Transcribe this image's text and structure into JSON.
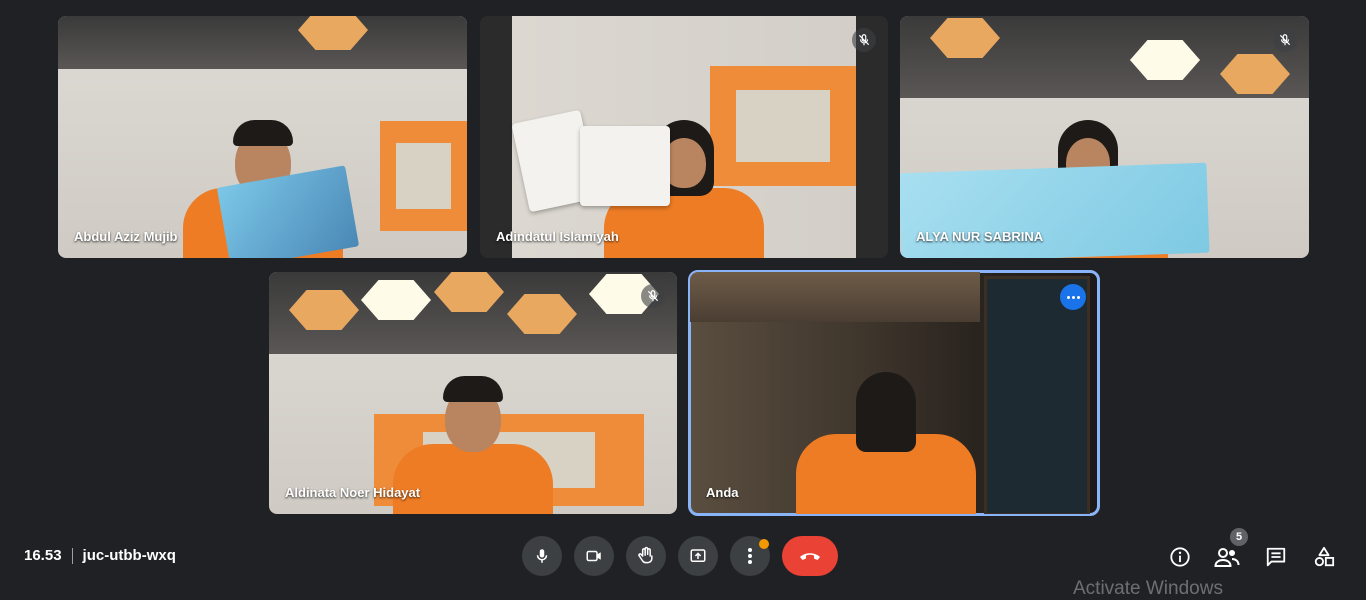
{
  "participants": [
    {
      "name": "Abdul Aziz Mujib",
      "muted": false
    },
    {
      "name": "Adindatul Islamiyah",
      "muted": true
    },
    {
      "name": "ALYA NUR SABRINA",
      "muted": true
    },
    {
      "name": "Aldinata Noer Hidayat",
      "muted": true
    },
    {
      "name": "Anda",
      "muted": false,
      "active_speaker": true
    }
  ],
  "bottom_bar": {
    "time": "16.53",
    "meeting_code": "juc-utbb-wxq",
    "controls": [
      {
        "name": "microphone",
        "icon": "microphone-icon"
      },
      {
        "name": "camera",
        "icon": "video-camera-icon"
      },
      {
        "name": "raise-hand",
        "icon": "hand-icon"
      },
      {
        "name": "present-screen",
        "icon": "present-icon"
      },
      {
        "name": "more-options",
        "icon": "more-vert-icon",
        "has_notification": true
      },
      {
        "name": "end-call",
        "icon": "phone-hangup-icon"
      }
    ],
    "right_icons": [
      {
        "name": "meeting-details",
        "icon": "info-icon"
      },
      {
        "name": "people",
        "icon": "people-icon",
        "badge": "5"
      },
      {
        "name": "chat",
        "icon": "chat-icon"
      },
      {
        "name": "activities",
        "icon": "activities-icon"
      }
    ]
  },
  "colors": {
    "background": "#202124",
    "control": "#3c4043",
    "end_call": "#ea4335",
    "active_border": "#8ab4f8",
    "accent_blue": "#1a73e8",
    "notification_dot": "#f29900"
  },
  "watermark": "Activate Windows"
}
